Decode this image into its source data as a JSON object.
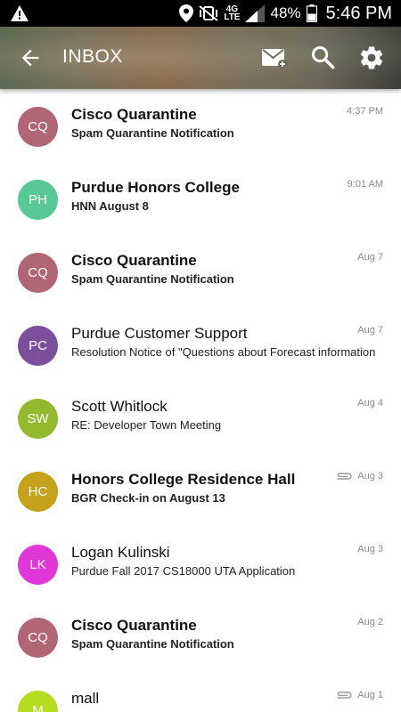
{
  "status_bar": {
    "battery": "48%",
    "time": "5:46 PM",
    "network": "4G LTE"
  },
  "header": {
    "title": "INBOX",
    "icons": [
      "back-arrow-icon",
      "compose-mail-icon",
      "search-icon",
      "gear-icon"
    ]
  },
  "emails": [
    {
      "initials": "CQ",
      "sender": "Cisco Quarantine",
      "subject": "Spam Quarantine Notification",
      "date": "4:37 PM",
      "unread": true,
      "attachment": false,
      "color": "#b06674"
    },
    {
      "initials": "PH",
      "sender": "Purdue Honors College",
      "subject": "HNN August 8",
      "date": "9:01 AM",
      "unread": true,
      "attachment": false,
      "color": "#58c996"
    },
    {
      "initials": "CQ",
      "sender": "Cisco Quarantine",
      "subject": "Spam Quarantine Notification",
      "date": "Aug 7",
      "unread": true,
      "attachment": false,
      "color": "#b06674"
    },
    {
      "initials": "PC",
      "sender": "Purdue Customer Support",
      "subject": "Resolution Notice of \"Questions about Forecast information",
      "date": "Aug 7",
      "unread": false,
      "attachment": false,
      "color": "#7b4f9c"
    },
    {
      "initials": "SW",
      "sender": "Scott Whitlock",
      "subject": "RE: Developer Town Meeting",
      "date": "Aug 4",
      "unread": false,
      "attachment": false,
      "color": "#93ba2e"
    },
    {
      "initials": "HC",
      "sender": "Honors College Residence Hall",
      "subject": "BGR Check-in on August 13",
      "date": "Aug 3",
      "unread": true,
      "attachment": true,
      "color": "#c4a21c"
    },
    {
      "initials": "LK",
      "sender": "Logan Kulinski",
      "subject": "Purdue Fall 2017 CS18000 UTA Application",
      "date": "Aug 3",
      "unread": false,
      "attachment": false,
      "color": "#e137d8"
    },
    {
      "initials": "CQ",
      "sender": "Cisco Quarantine",
      "subject": "Spam Quarantine Notification",
      "date": "Aug 2",
      "unread": true,
      "attachment": false,
      "color": "#b06674"
    },
    {
      "initials": "M",
      "sender": "mall",
      "subject": "",
      "date": "Aug 1",
      "unread": false,
      "attachment": true,
      "color": "#b7dd22"
    }
  ]
}
